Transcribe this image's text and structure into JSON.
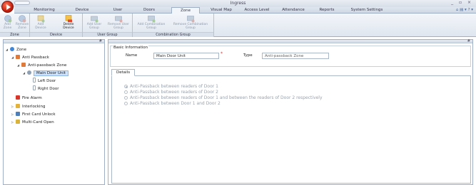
{
  "app": {
    "title": "Ingress",
    "window_controls": "_ ▫ ×"
  },
  "tabs": [
    {
      "label": "Monitoring"
    },
    {
      "label": "Device"
    },
    {
      "label": "User"
    },
    {
      "label": "Doors"
    },
    {
      "label": "Zone",
      "active": true
    },
    {
      "label": "Visual Map"
    },
    {
      "label": "Access Level"
    },
    {
      "label": "Attendance"
    },
    {
      "label": "Reports"
    },
    {
      "label": "System Settings"
    }
  ],
  "tabs_right": "⌂ ▤ ▾ ? ▾",
  "ribbon": {
    "groups": [
      {
        "label": "Zone",
        "buttons": [
          {
            "label1": "Add",
            "label2": "Zone",
            "enabled": false
          },
          {
            "label1": "Remove",
            "label2": "Zone",
            "enabled": false
          }
        ]
      },
      {
        "label": "Device",
        "buttons": [
          {
            "label1": "Add",
            "label2": "Device",
            "enabled": false
          },
          {
            "label1": "Delete",
            "label2": "Device",
            "enabled": true
          }
        ]
      },
      {
        "label": "User Group",
        "buttons": [
          {
            "label1": "Add User",
            "label2": "Group",
            "enabled": false
          },
          {
            "label1": "Remove User",
            "label2": "Group",
            "enabled": false
          }
        ]
      },
      {
        "label": "Combination Group",
        "buttons": [
          {
            "label1": "Add Combination",
            "label2": "Group",
            "enabled": false
          },
          {
            "label1": "Remove Combination",
            "label2": "Group",
            "enabled": false
          }
        ]
      }
    ]
  },
  "tree": {
    "pin": "#",
    "items": [
      {
        "label": "Zone",
        "icon": "globe-icon",
        "expander": "◢"
      },
      {
        "label": "Anti Passback",
        "icon": "shield-icon",
        "expander": "◢"
      },
      {
        "label": "Anti-passback Zone",
        "icon": "shield-icon",
        "expander": "◢"
      },
      {
        "label": "Main Door Unit",
        "icon": "door-unit-icon",
        "expander": "◢",
        "selected": true
      },
      {
        "label": "Left Door",
        "icon": "door-icon",
        "expander": ""
      },
      {
        "label": "Right Door",
        "icon": "door-icon",
        "expander": ""
      },
      {
        "label": "Fire Alarm",
        "icon": "fire-alarm-icon",
        "expander": ""
      },
      {
        "label": "Interlocking",
        "icon": "lock-icon",
        "expander": "▷"
      },
      {
        "label": "First Card Unlock",
        "icon": "card-icon",
        "expander": "▷"
      },
      {
        "label": "Multi-Card Open",
        "icon": "cards-icon",
        "expander": "▷"
      }
    ]
  },
  "content": {
    "pin": "#",
    "basic_info_title": "Basic Information",
    "name_label": "Name",
    "name_value": "Main Door Unit",
    "required_mark": "*",
    "type_label": "Type",
    "type_value": "Anti-passback Zone",
    "details_tab": "Details",
    "options": [
      {
        "label": "Anti-Passback between readers of Door 1",
        "checked": true
      },
      {
        "label": "Anti-Passback between readers of Door 2",
        "checked": false
      },
      {
        "label": "Anti-Passback between readers of Door 1 and between the readers of Door 2 respectively",
        "checked": false
      },
      {
        "label": "Anti-Passback between Door 1 and Door 2",
        "checked": false
      }
    ]
  }
}
